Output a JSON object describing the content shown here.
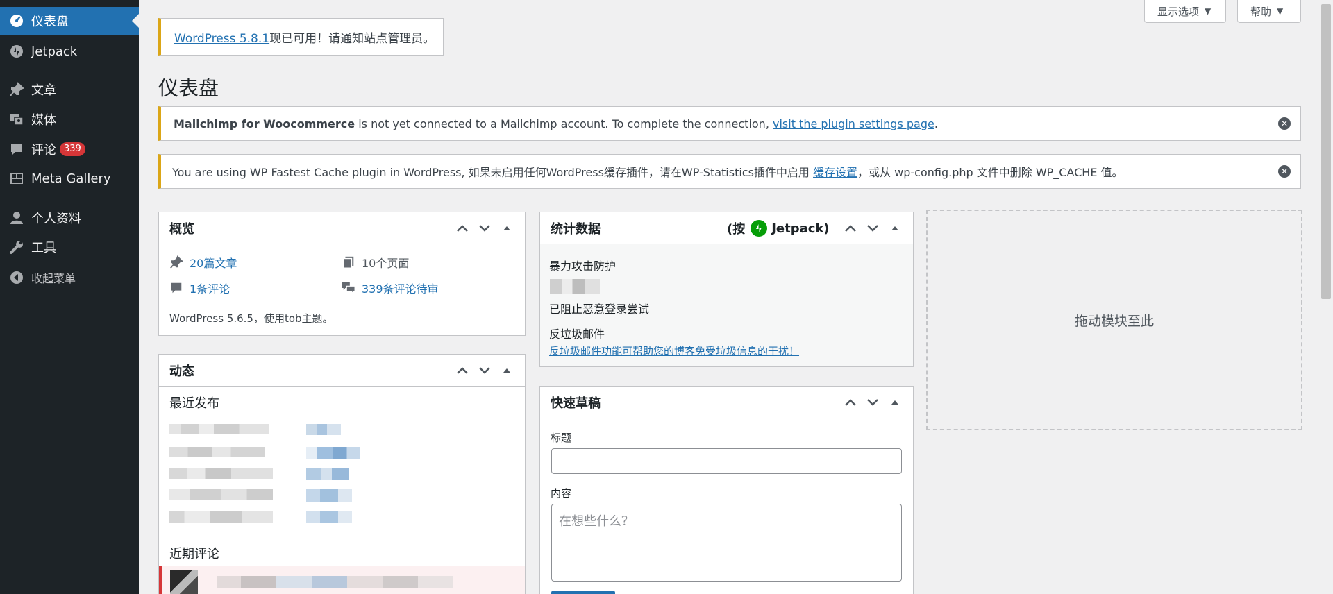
{
  "sidebar": {
    "items": [
      {
        "label": "仪表盘",
        "icon": "dashboard-icon",
        "active": true
      },
      {
        "label": "Jetpack",
        "icon": "jetpack-icon"
      },
      {
        "label": "文章",
        "icon": "pin-icon"
      },
      {
        "label": "媒体",
        "icon": "media-icon"
      },
      {
        "label": "评论",
        "icon": "comment-icon",
        "badge": "339"
      },
      {
        "label": "Meta Gallery",
        "icon": "gallery-icon"
      },
      {
        "label": "个人资料",
        "icon": "user-icon"
      },
      {
        "label": "工具",
        "icon": "wrench-icon"
      },
      {
        "label": "收起菜单",
        "icon": "collapse-icon"
      }
    ]
  },
  "top_tabs": {
    "screen_options": "显示选项",
    "help": "帮助"
  },
  "update_notice": {
    "link": "WordPress 5.8.1",
    "text": "现已可用！请通知站点管理员。"
  },
  "page_title": "仪表盘",
  "mailchimp_notice": {
    "bold": "Mailchimp for Woocommerce",
    "text": " is not yet connected to a Mailchimp account. To complete the connection, ",
    "link": "visit the plugin settings page",
    "end": "."
  },
  "cache_notice": {
    "text": "You are using WP Fastest Cache plugin in WordPress, 如果未启用任何WordPress缓存插件，请在WP-Statistics插件中启用 ",
    "link": "缓存设置",
    "end": "，或从 wp-config.php 文件中删除 WP_CACHE 值。"
  },
  "at_a_glance": {
    "title": "概览",
    "posts": "20篇文章",
    "pages": "10个页面",
    "comments": "1条评论",
    "pending": "339条评论待审",
    "footer": "WordPress 5.6.5，使用tob主题。"
  },
  "activity": {
    "title": "动态",
    "recent_published": "最近发布",
    "recent_comments": "近期评论"
  },
  "stats": {
    "title": "统计数据",
    "by_prefix": "(按",
    "by_brand": "Jetpack",
    "by_suffix": ")",
    "brute_force": "暴力攻击防护",
    "blocked": "已阻止恶意登录尝试",
    "anti_spam": "反垃圾邮件",
    "anti_spam_link": "反垃圾邮件功能可帮助您的博客免受垃圾信息的干扰！"
  },
  "quick_draft": {
    "title": "快速草稿",
    "title_label": "标题",
    "title_value": "",
    "content_label": "内容",
    "content_placeholder": "在想些什么？"
  },
  "drop_zone": {
    "label": "拖动模块至此"
  },
  "colors": {
    "sidebar_bg": "#1d2327",
    "accent": "#2271b1",
    "warning_border": "#dba617",
    "badge": "#d63638",
    "jetpack_green": "#069e08"
  }
}
